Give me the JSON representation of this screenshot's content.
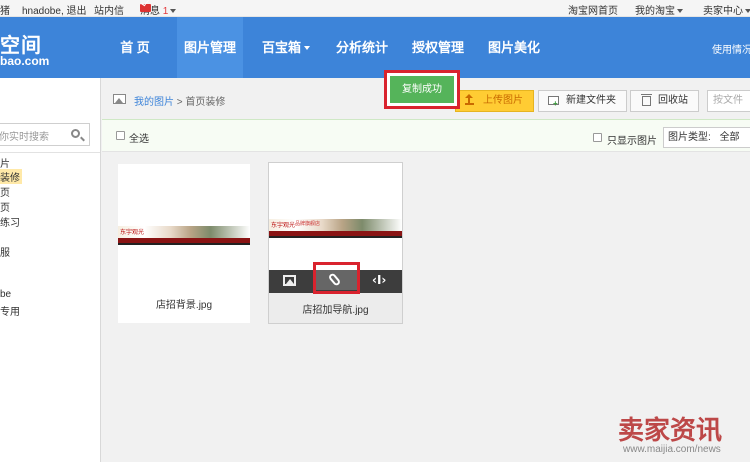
{
  "topbar": {
    "left_fragment": "猪",
    "user": "hnadobe",
    "logout": "退出",
    "messages_link": "站内信",
    "news_label": "消息",
    "news_count": "1",
    "taobao_home": "淘宝网首页",
    "my_taobao": "我的淘宝",
    "seller_center": "卖家中心"
  },
  "logo": {
    "line1": "空间",
    "line2": "bao.com"
  },
  "nav": {
    "items": [
      "首 页",
      "图片管理",
      "百宝箱",
      "分析统计",
      "授权管理",
      "图片美化"
    ],
    "help": "使用情况"
  },
  "sidebar": {
    "search_placeholder": "你实时搜索",
    "tree": [
      "片",
      "装修",
      "页",
      "页",
      "练习",
      "服",
      "be",
      "专用"
    ]
  },
  "breadcrumb": {
    "root": "我的图片",
    "separator": ">",
    "current": "首页装修"
  },
  "toast": "复制成功",
  "toolbar": {
    "upload": "上传图片",
    "new_folder": "新建文件夹",
    "recycle": "回收站",
    "search_placeholder": "按文件"
  },
  "filterbar": {
    "select_all": "全选",
    "only_images": "只显示图片",
    "type_label": "图片类型:",
    "type_value": "全部"
  },
  "files": [
    {
      "name": "店招背景.jpg",
      "banner_tag": "东宇观光"
    },
    {
      "name": "店招加导航.jpg",
      "banner_tag": "东宇观光",
      "banner_sub": "品牌旗舰店"
    }
  ],
  "watermark": {
    "brand": "卖家资讯",
    "url": "www.maijia.com/news"
  }
}
